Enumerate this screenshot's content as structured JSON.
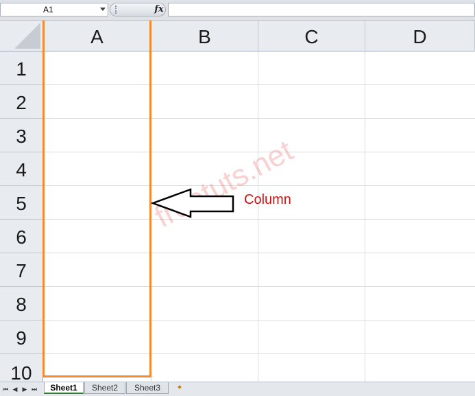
{
  "formula_bar": {
    "name_box": "A1",
    "fx_label": "fx",
    "formula_value": ""
  },
  "columns": [
    "A",
    "B",
    "C",
    "D"
  ],
  "rows": [
    "1",
    "2",
    "3",
    "4",
    "5",
    "6",
    "7",
    "8",
    "9",
    "10"
  ],
  "annotation": {
    "label": "Column",
    "color": "#d01010",
    "highlight_color": "#f28a30"
  },
  "watermark": "freetuts.net",
  "sheets": {
    "nav_icons": [
      "first-sheet-icon",
      "prev-sheet-icon",
      "next-sheet-icon",
      "last-sheet-icon"
    ],
    "tabs": [
      {
        "label": "Sheet1",
        "active": true
      },
      {
        "label": "Sheet2",
        "active": false
      },
      {
        "label": "Sheet3",
        "active": false
      }
    ],
    "insert_icon": "insert-worksheet-icon"
  }
}
